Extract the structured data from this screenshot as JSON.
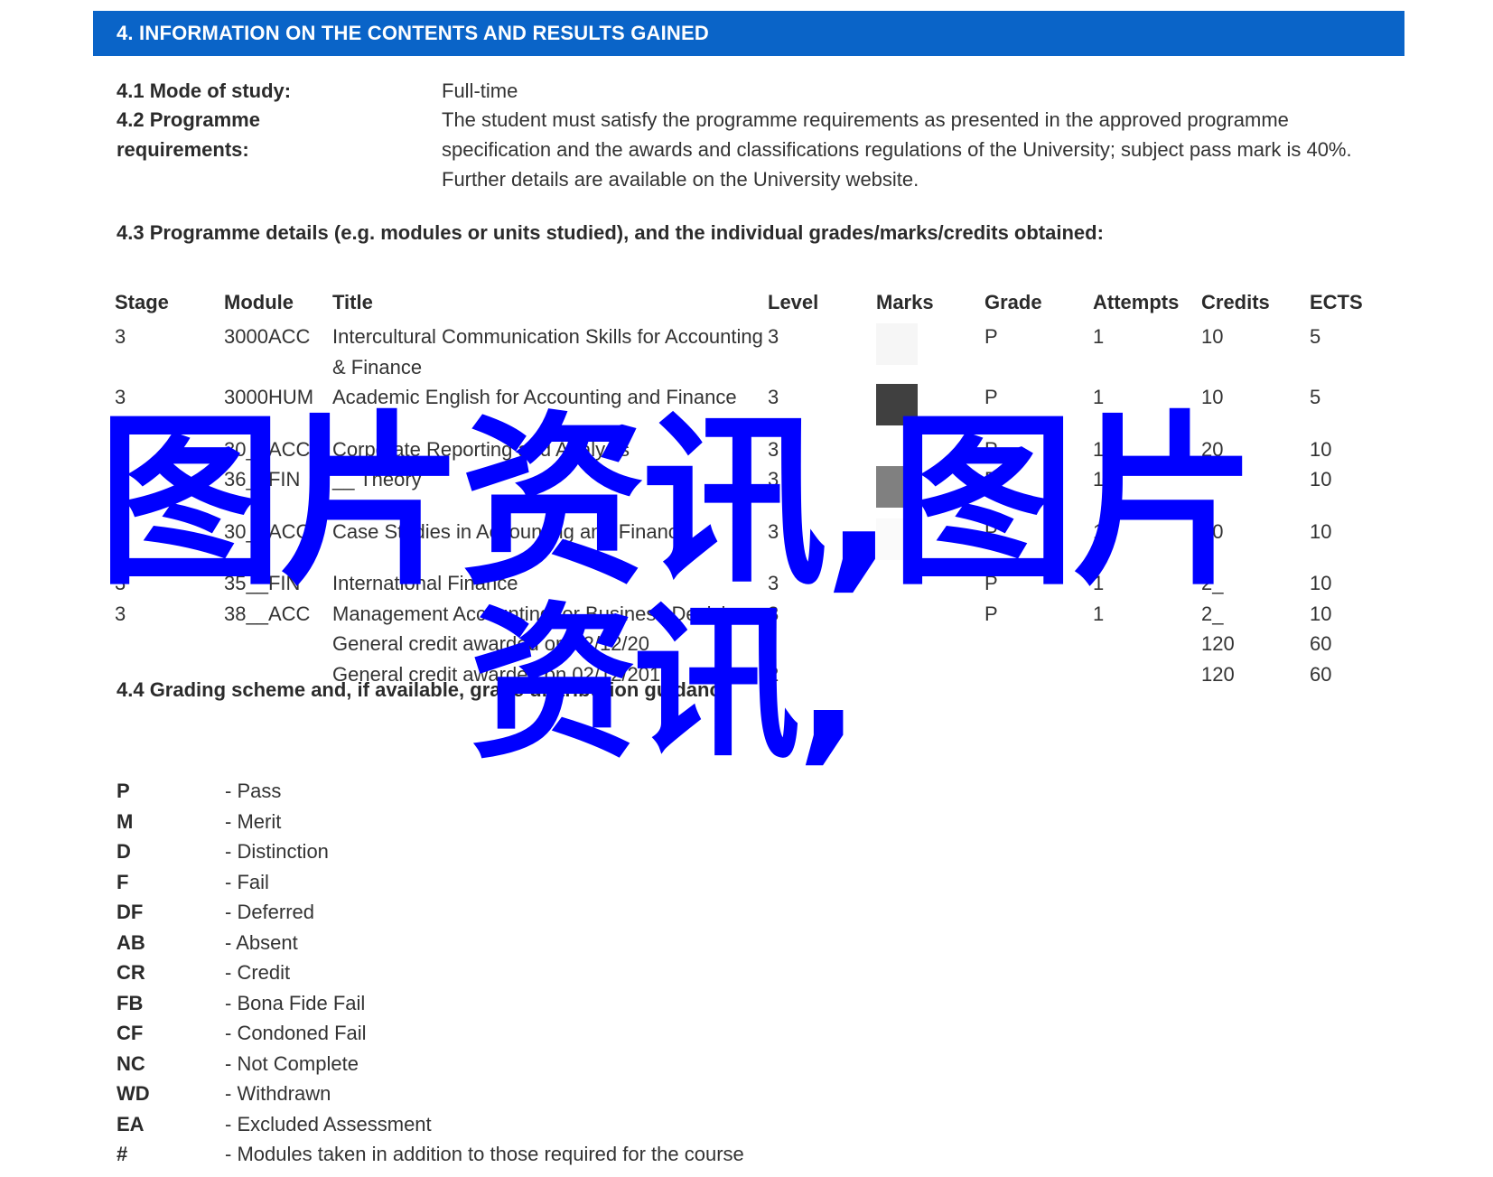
{
  "banner": {
    "title": "4. INFORMATION ON THE CONTENTS AND RESULTS GAINED",
    "color": "#0a64c8"
  },
  "fields": [
    {
      "label": "4.1 Mode of study:",
      "value": "Full-time"
    },
    {
      "label": "4.2 Programme requirements:",
      "value": "The student must satisfy the programme requirements as presented in the approved programme specification and the awards and classifications regulations of the University; subject pass mark is 40%. Further details are available on the University website."
    }
  ],
  "programme_details": {
    "heading": "4.3 Programme details (e.g. modules or units studied), and the individual grades/marks/credits obtained:",
    "columns": [
      "Stage",
      "Module",
      "Title",
      "Level",
      "Marks",
      "Grade",
      "Attempts",
      "Credits",
      "ECTS"
    ],
    "rows": [
      {
        "stage": "3",
        "module": "3000ACC",
        "title": "Intercultural Communication Skills for Accounting & Finance",
        "level": "3",
        "marks_shade": "#f6f6f6",
        "grade": "P",
        "attempts": "1",
        "credits": "10",
        "ects": "5"
      },
      {
        "stage": "3",
        "module": "3000HUM",
        "title": "Academic English for Accounting and Finance",
        "level": "3",
        "marks_shade": "#404040",
        "grade": "P",
        "attempts": "1",
        "credits": "10",
        "ects": "5"
      },
      {
        "stage": "3",
        "module": "30__ACC",
        "title": "Corporate Reporting and Analysis",
        "level": "3",
        "marks_shade": "",
        "grade": "P",
        "attempts": "1",
        "credits": "20",
        "ects": "10"
      },
      {
        "stage": "3",
        "module": "36__FIN",
        "title": "__ Theory",
        "level": "3",
        "marks_shade": "#808080",
        "grade": "P",
        "attempts": "1",
        "credits": "",
        "ects": "10"
      },
      {
        "stage": "3",
        "module": "30__ACC",
        "title": "Case Studies in Accounting and Finance",
        "level": "3",
        "marks_shade": "#fafafa",
        "grade": "P",
        "attempts": "1",
        "credits": "20",
        "ects": "10"
      },
      {
        "stage": "3",
        "module": "35__FIN",
        "title": "International Finance",
        "level": "3",
        "marks_shade": "",
        "grade": "P",
        "attempts": "1",
        "credits": "2_",
        "ects": "10"
      },
      {
        "stage": "3",
        "module": "38__ACC",
        "title": "Management Accounting for Business Decisions",
        "level": "3",
        "marks_shade": "",
        "grade": "P",
        "attempts": "1",
        "credits": "2_",
        "ects": "10"
      },
      {
        "stage": "",
        "module": "",
        "title": "General credit awarded on 02/12/20__",
        "level": "",
        "marks_shade": "",
        "grade": "",
        "attempts": "",
        "credits": "120",
        "ects": "60"
      },
      {
        "stage": "",
        "module": "",
        "title": "General credit awarded on 02/12/2019",
        "level": "2",
        "marks_shade": "",
        "grade": "",
        "attempts": "",
        "credits": "120",
        "ects": "60"
      }
    ]
  },
  "grading": {
    "heading": "4.4 Grading scheme and, if available, grade distribution guidance",
    "items": [
      {
        "code": "P",
        "desc": "- Pass"
      },
      {
        "code": "M",
        "desc": "- Merit"
      },
      {
        "code": "D",
        "desc": "- Distinction"
      },
      {
        "code": "F",
        "desc": "- Fail"
      },
      {
        "code": "DF",
        "desc": "- Deferred"
      },
      {
        "code": "AB",
        "desc": "- Absent"
      },
      {
        "code": "CR",
        "desc": "- Credit"
      },
      {
        "code": "FB",
        "desc": "- Bona Fide Fail"
      },
      {
        "code": "CF",
        "desc": "- Condoned Fail"
      },
      {
        "code": "NC",
        "desc": "- Not Complete"
      },
      {
        "code": "WD",
        "desc": "- Withdrawn"
      },
      {
        "code": "EA",
        "desc": "- Excluded Assessment"
      },
      {
        "code": "#",
        "desc": "- Modules taken in addition to those required for the course"
      }
    ]
  },
  "watermark": {
    "line1": "图片资讯,图片",
    "line2": "资讯,",
    "color": "#0000ff"
  }
}
